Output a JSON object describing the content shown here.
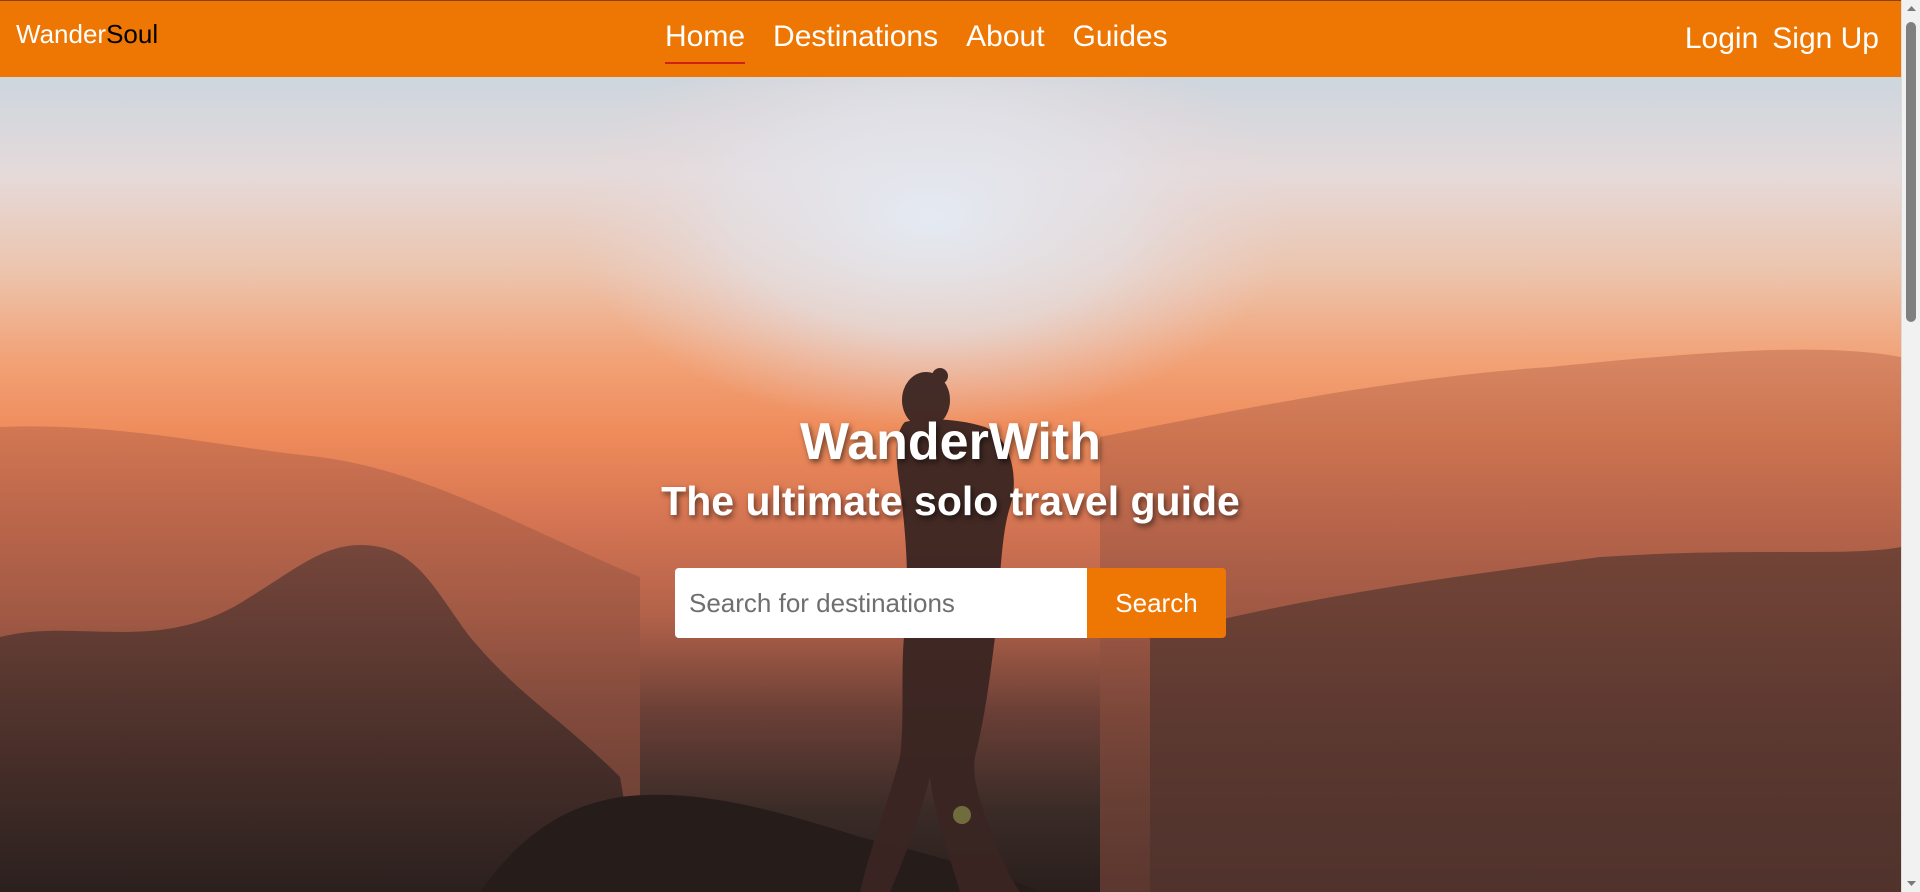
{
  "navbar": {
    "brand_part1": "Wander",
    "brand_part2": "Soul",
    "links": [
      {
        "label": "Home",
        "active": true
      },
      {
        "label": "Destinations",
        "active": false
      },
      {
        "label": "About",
        "active": false
      },
      {
        "label": "Guides",
        "active": false
      }
    ],
    "login_label": "Login",
    "signup_label": "Sign Up"
  },
  "hero": {
    "title": "WanderWith",
    "subtitle": "The ultimate solo travel guide",
    "search_placeholder": "Search for destinations",
    "search_value": "",
    "search_button": "Search"
  },
  "colors": {
    "accent": "#ee7603",
    "active_underline": "#d0201a",
    "text_light": "#ffffff"
  },
  "icons": {
    "scroll_up": "triangle-up-icon",
    "scroll_down": "triangle-down-icon"
  }
}
